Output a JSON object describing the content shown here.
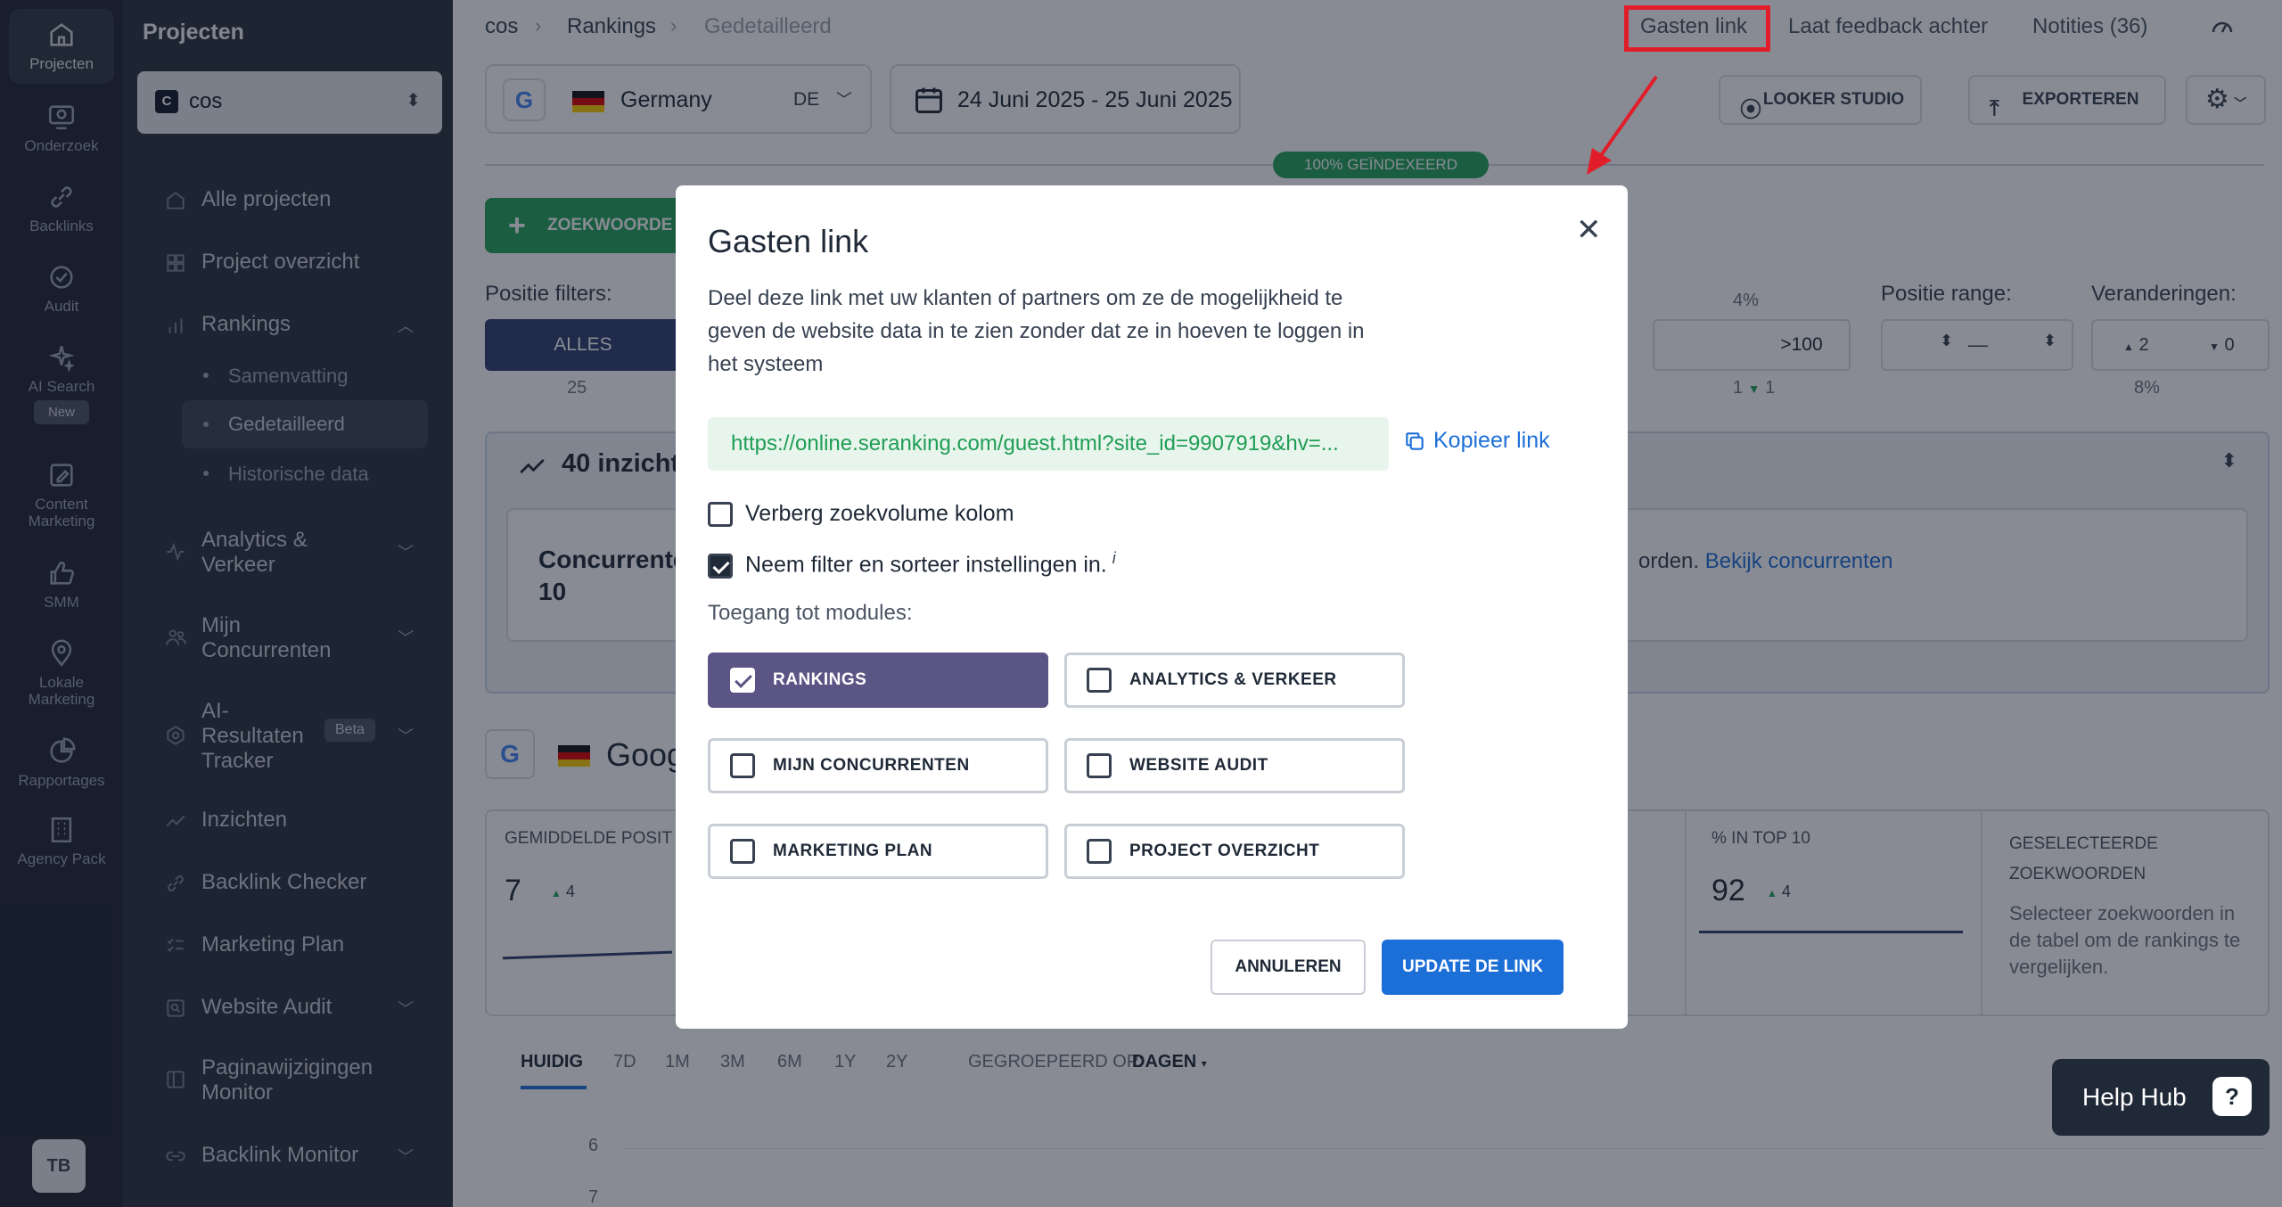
{
  "rail": {
    "items": [
      {
        "label": "Projecten",
        "icon": "home-icon"
      },
      {
        "label": "Onderzoek",
        "icon": "research-icon"
      },
      {
        "label": "Backlinks",
        "icon": "link-icon"
      },
      {
        "label": "Audit",
        "icon": "check-circle-icon"
      },
      {
        "label": "AI Search",
        "icon": "sparkle-icon"
      },
      {
        "label": "Content Marketing",
        "icon": "edit-icon"
      },
      {
        "label": "SMM",
        "icon": "thumbs-up-icon"
      },
      {
        "label": "Lokale Marketing",
        "icon": "map-pin-icon"
      },
      {
        "label": "Rapportages",
        "icon": "pie-chart-icon"
      },
      {
        "label": "Agency Pack",
        "icon": "building-icon"
      }
    ],
    "new_badge": "New",
    "avatar_initials": "TB"
  },
  "sidebar": {
    "title": "Projecten",
    "project_name": "cos",
    "project_badge": "C",
    "items": [
      {
        "label": "Alle projecten"
      },
      {
        "label": "Project overzicht"
      },
      {
        "label": "Rankings"
      },
      {
        "label": "Analytics & Verkeer"
      },
      {
        "label": "Mijn Concurrenten"
      },
      {
        "label": "AI-Resultaten Tracker"
      },
      {
        "label": "Inzichten"
      },
      {
        "label": "Backlink Checker"
      },
      {
        "label": "Marketing Plan"
      },
      {
        "label": "Website Audit"
      },
      {
        "label": "Paginawijzigingen Monitor"
      },
      {
        "label": "Backlink Monitor"
      }
    ],
    "sub_items": [
      {
        "label": "Samenvatting"
      },
      {
        "label": "Gedetailleerd"
      },
      {
        "label": "Historische data"
      }
    ],
    "beta": "Beta"
  },
  "header": {
    "breadcrumb": [
      "cos",
      "Rankings",
      "Gedetailleerd"
    ],
    "links": {
      "gasten": "Gasten link",
      "feedback": "Laat feedback achter",
      "notities": "Notities (36)"
    }
  },
  "toolbar": {
    "country": "Germany",
    "country_code": "DE",
    "date_range": "24 Juni 2025 - 25 Juni 2025",
    "looker": "LOOKER STUDIO",
    "export": "EXPORTEREN",
    "indexed": "100% GEÏNDEXEERD",
    "add_keywords": "ZOEKWOORDE"
  },
  "filters": {
    "label": "Positie filters:",
    "all_tab": "ALLES",
    "all_count": "25",
    "pct4": "4%",
    "gt100": ">100",
    "gt100_sub": "1",
    "gt100_sub2": "1",
    "range_label": "Positie range:",
    "range_dash": "—",
    "changes_label": "Veranderingen:",
    "up": "2",
    "down": "0",
    "changes_pct": "8%"
  },
  "insights": {
    "title": "40 inzicht",
    "competitors_label": "Concurrente",
    "competitors_count": "10",
    "text_tail": "orden.",
    "link": "Bekijk concurrenten"
  },
  "google_section": {
    "title": "Goog",
    "avg_label": "GEMIDDELDE POSIT",
    "avg_value": "7",
    "avg_delta": "4",
    "top10_label": "% IN TOP 10",
    "top10_value": "92",
    "top10_delta": "4",
    "selected_label": "GESELECTEERDE ZOEKWOORDEN",
    "selected_text": "Selecteer zoekwoorden in de tabel om de rankings te vergelijken."
  },
  "periods": {
    "tabs": [
      "HUIDIG",
      "7D",
      "1M",
      "3M",
      "6M",
      "1Y",
      "2Y"
    ],
    "group_label": "GEGROEPEERD OP:",
    "group_value": "DAGEN",
    "y_tick_6": "6",
    "y_tick_7": "7"
  },
  "modal": {
    "title": "Gasten link",
    "description": "Deel deze link met uw klanten of partners om ze de mogelijkheid te geven de website data in te zien zonder dat ze in hoeven te loggen in het systeem",
    "link": "https://online.seranking.com/guest.html?site_id=9907919&hv=...",
    "copy": "Kopieer link",
    "option_hide_volume": "Verberg zoekvolume kolom",
    "option_include_filters": "Neem filter en sorteer instellingen in.",
    "info": "i",
    "modules_label": "Toegang tot modules:",
    "modules": [
      {
        "label": "RANKINGS",
        "checked": true
      },
      {
        "label": "ANALYTICS & VERKEER",
        "checked": false
      },
      {
        "label": "MIJN CONCURRENTEN",
        "checked": false
      },
      {
        "label": "WEBSITE AUDIT",
        "checked": false
      },
      {
        "label": "MARKETING PLAN",
        "checked": false
      },
      {
        "label": "PROJECT OVERZICHT",
        "checked": false
      }
    ],
    "cancel": "ANNULEREN",
    "update": "UPDATE DE LINK"
  },
  "helphub": {
    "label": "Help Hub"
  },
  "colors": {
    "accent_blue": "#1d6fd8",
    "module_selected": "#5b5585",
    "highlight_red": "#e11d2a",
    "success_green": "#22a35a"
  }
}
